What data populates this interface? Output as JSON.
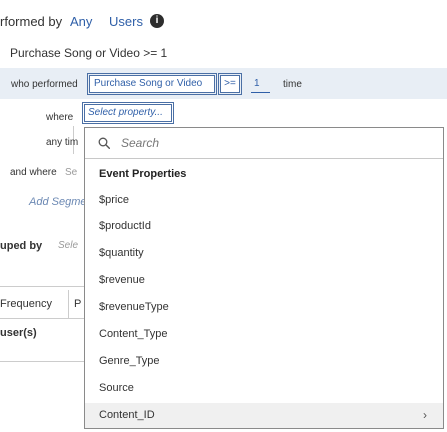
{
  "header": {
    "performed_by_prefix": "rformed by",
    "any_label": "Any",
    "users_label": "Users",
    "info_glyph": "i",
    "segment_title": "Purchase Song or Video >= 1"
  },
  "condition": {
    "who_performed_label": "who performed",
    "event_value": "Purchase Song or Video",
    "operator_value": ">=",
    "count_value": "1",
    "time_label": "time",
    "where_label": "where",
    "property_placeholder": "Select property...",
    "anytime_label": "any tim",
    "and_where_label": "and where",
    "and_where_select": "Se",
    "add_segment_label": "Add Segmen"
  },
  "grouping": {
    "grouped_by_label": "uped by",
    "grouped_by_select": "Sele",
    "frequency_tab": "Frequency",
    "p_tab": "P",
    "users_label": "user(s)"
  },
  "dropdown": {
    "search_placeholder": "Search",
    "heading": "Event Properties",
    "items": [
      {
        "label": "$price"
      },
      {
        "label": "$productId"
      },
      {
        "label": "$quantity"
      },
      {
        "label": "$revenue"
      },
      {
        "label": "$revenueType"
      },
      {
        "label": "Content_Type"
      },
      {
        "label": "Genre_Type"
      },
      {
        "label": "Source"
      },
      {
        "label": "Content_ID"
      }
    ]
  },
  "icons": {
    "info": "info-icon",
    "search": "search-icon",
    "chevron": "chevron-right-icon",
    "chevron_glyph": "›"
  },
  "colors": {
    "accent": "#2f5fa8",
    "band": "#e8eef5",
    "hover": "#f0f0f0"
  }
}
